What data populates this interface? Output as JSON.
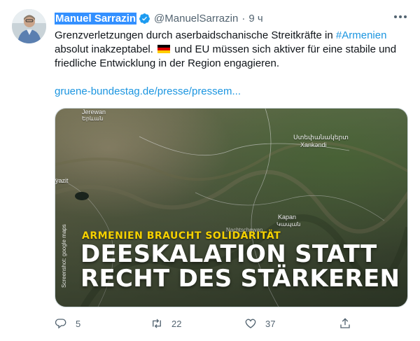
{
  "tweet": {
    "author_name": "Manuel Sarrazin",
    "handle": "@ManuelSarrazin",
    "separator": "·",
    "time": "9 ч",
    "text_line1_a": "Grenzverletzungen durch aserbaidschanische Streitkräfte in ",
    "hashtag": "#Armenien",
    "text_line2_a": "absolut inakzeptabel. ",
    "text_line2_b": " und EU müssen sich aktiver für eine stabile und",
    "text_line3": "friedliche Entwicklung in der Region engagieren.",
    "link": "gruene-bundestag.de/presse/pressem..."
  },
  "media": {
    "tagline": "ARMENIEN BRAUCHT SOLIDARITÄT",
    "headline_line1": "DEESKALATION STATT",
    "headline_line2": "RECHT DES STÄRKEREN",
    "credit": "Screenshot: google maps",
    "place_jerewan": "Jerewan",
    "place_jerewan_arm": "Երևան",
    "place_stepanakert": "Ստեփանակերտ",
    "place_xankandi": "Xankəndi",
    "place_kapan": "Kapan",
    "place_kapan_arm": "Կապան",
    "place_yazit": "yazit",
    "place_nacnzar": "Nachtschewan"
  },
  "actions": {
    "replies": "5",
    "retweets": "22",
    "likes": "37",
    "share": ""
  },
  "colors": {
    "link": "#1b95e0",
    "secondary_text": "#536471",
    "tagline": "#f5d100",
    "selection": "#3390ff"
  }
}
